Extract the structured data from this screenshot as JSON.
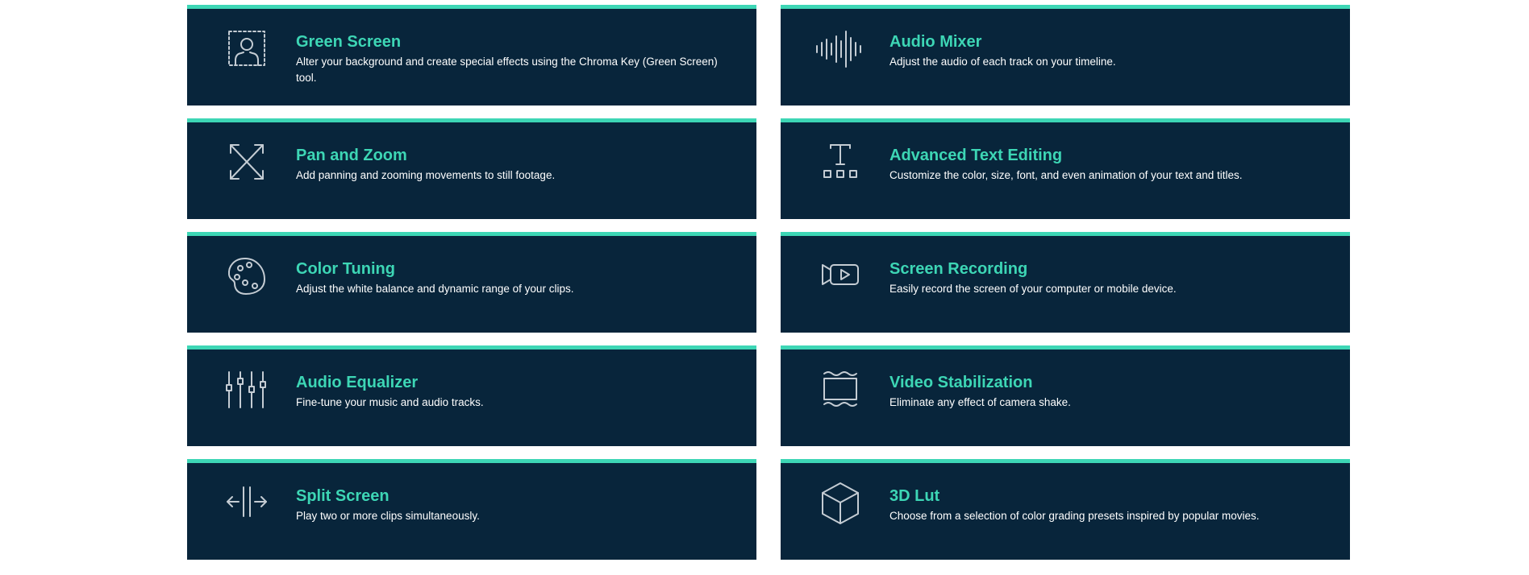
{
  "colors": {
    "card_background": "#08253b",
    "accent": "#3dd6b5",
    "icon_stroke": "#c4ccd3",
    "description_text": "#ffffff",
    "page_background": "#ffffff"
  },
  "features": [
    {
      "title": "Green Screen",
      "description": "Alter your background and create special effects using the Chroma Key (Green Screen) tool.",
      "icon": "green-screen-icon"
    },
    {
      "title": "Audio Mixer",
      "description": "Adjust the audio of each track on your timeline.",
      "icon": "audio-mixer-icon"
    },
    {
      "title": "Pan and Zoom",
      "description": "Add panning and zooming movements to still footage.",
      "icon": "pan-zoom-icon"
    },
    {
      "title": "Advanced Text Editing",
      "description": "Customize the color, size, font, and even animation of your text and titles.",
      "icon": "text-editing-icon"
    },
    {
      "title": "Color Tuning",
      "description": "Adjust the white balance and dynamic range of your clips.",
      "icon": "palette-icon"
    },
    {
      "title": "Screen Recording",
      "description": "Easily record the screen of your computer or mobile device.",
      "icon": "screen-recording-icon"
    },
    {
      "title": "Audio Equalizer",
      "description": "Fine-tune your music and audio tracks.",
      "icon": "equalizer-icon"
    },
    {
      "title": "Video Stabilization",
      "description": "Eliminate any effect of camera shake.",
      "icon": "stabilization-icon"
    },
    {
      "title": "Split Screen",
      "description": "Play two or more clips simultaneously.",
      "icon": "split-screen-icon"
    },
    {
      "title": "3D Lut",
      "description": "Choose from a selection of color grading presets inspired by popular movies.",
      "icon": "3d-lut-cube-icon"
    }
  ]
}
